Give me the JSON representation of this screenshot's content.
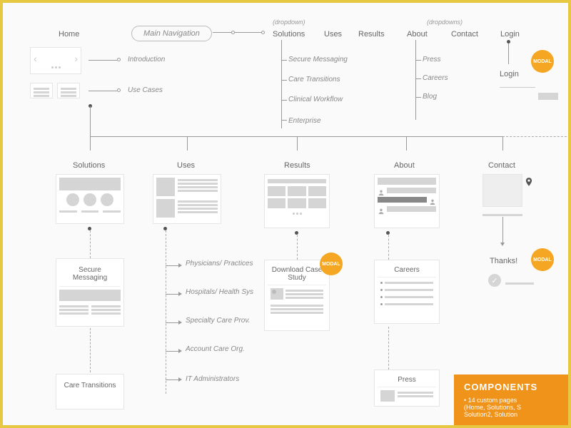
{
  "nav": {
    "home": "Home",
    "main": "Main Navigation",
    "solutions": "Solutions",
    "uses": "Uses",
    "results": "Results",
    "about": "About",
    "contact": "Contact",
    "login": "Login"
  },
  "labels": {
    "dropdown": "(dropdown)",
    "dropdowns": "(dropdowns)",
    "introduction": "Introduction",
    "use_cases": "Use Cases",
    "login2": "Login",
    "modal": "MODAL",
    "thanks": "Thanks!"
  },
  "solutions_menu": {
    "secure_messaging": "Secure Messaging",
    "care_transitions": "Care Transitions",
    "clinical_workflow": "Clinical Workflow",
    "enterprise": "Enterprise"
  },
  "about_menu": {
    "press": "Press",
    "careers": "Careers",
    "blog": "Blog"
  },
  "sections": {
    "solutions": "Solutions",
    "uses": "Uses",
    "results": "Results",
    "about": "About",
    "contact": "Contact"
  },
  "detail": {
    "secure_messaging": "Secure Messaging",
    "care_transitions": "Care Transitions",
    "download_case": "Download Case Study",
    "careers": "Careers",
    "press": "Press"
  },
  "uses_list": {
    "physicians": "Physicians/ Practices",
    "hospitals": "Hospitals/ Health Sys",
    "specialty": "Specialty Care Prov.",
    "account": "Account Care Org.",
    "it_admin": "IT Administrators"
  },
  "components": {
    "title": "COMPONENTS",
    "line1": "14 custom pages",
    "line2": "(Home, Solutions, S",
    "line3": "Solution2, Solution"
  }
}
